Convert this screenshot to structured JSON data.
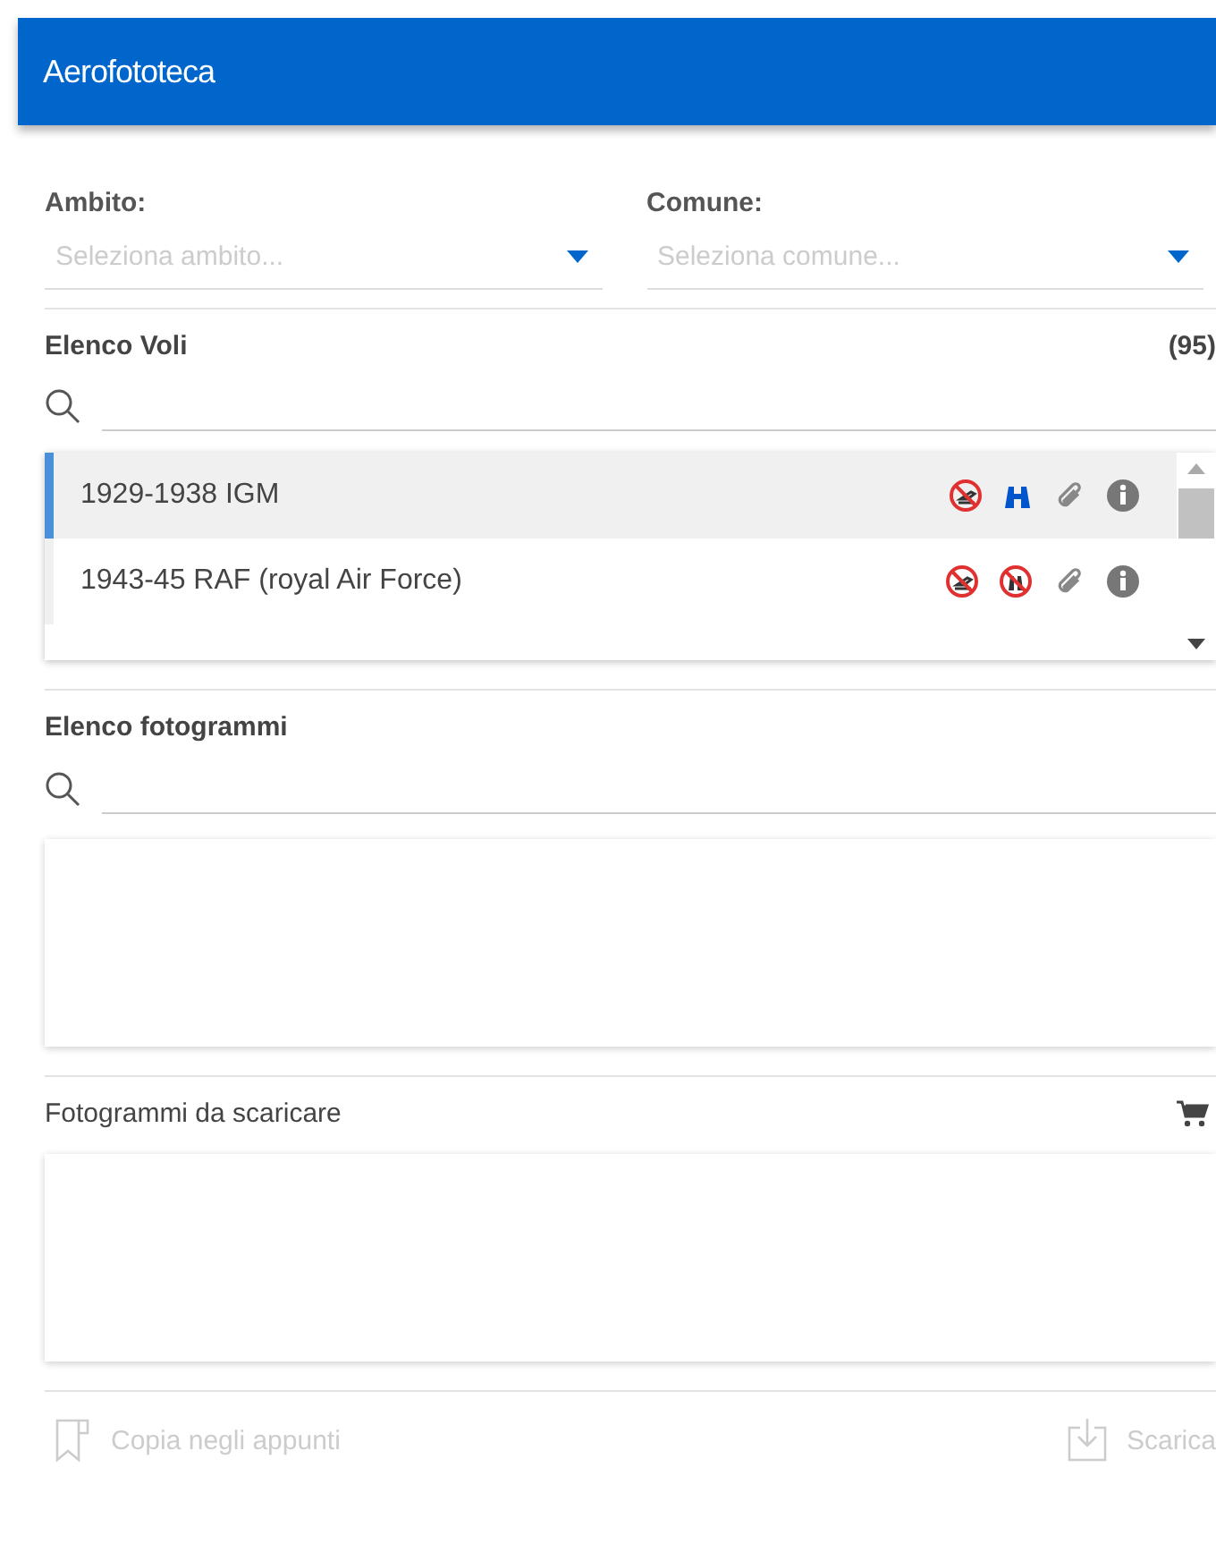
{
  "header": {
    "title": "Aerofototeca"
  },
  "filters": [
    {
      "label": "Ambito:",
      "placeholder": "Seleziona ambito..."
    },
    {
      "label": "Comune:",
      "placeholder": "Seleziona comune..."
    }
  ],
  "flights": {
    "title": "Elenco Voli",
    "count": "(95)",
    "rows": [
      {
        "name": "1929-1938 IGM",
        "selected": true,
        "photos_available": false,
        "view_available": true
      },
      {
        "name": "1943-45 RAF (royal Air Force)",
        "selected": false,
        "photos_available": false,
        "view_available": false
      }
    ]
  },
  "frames": {
    "title": "Elenco fotogrammi"
  },
  "downloads": {
    "title": "Fotogrammi da scaricare"
  },
  "footer": [
    {
      "kind": "copy",
      "label": "Copia negli appunti",
      "disabled": true
    },
    {
      "kind": "download",
      "label": "Scarica",
      "disabled": true
    }
  ]
}
